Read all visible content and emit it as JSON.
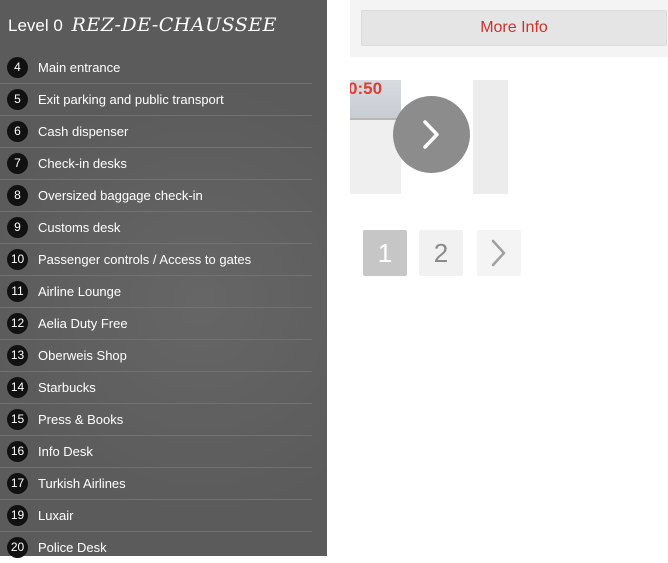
{
  "panel": {
    "level_label": "Level 0",
    "level_name": "REZ-DE-CHAUSSEE",
    "items": [
      {
        "num": "4",
        "label": "Main entrance"
      },
      {
        "num": "5",
        "label": "Exit parking and public transport"
      },
      {
        "num": "6",
        "label": "Cash dispenser"
      },
      {
        "num": "7",
        "label": "Check-in desks"
      },
      {
        "num": "8",
        "label": "Oversized baggage check-in"
      },
      {
        "num": "9",
        "label": "Customs desk"
      },
      {
        "num": "10",
        "label": "Passenger controls / Access to gates"
      },
      {
        "num": "11",
        "label": "Airline Lounge"
      },
      {
        "num": "12",
        "label": "Aelia Duty Free"
      },
      {
        "num": "13",
        "label": "Oberweis Shop"
      },
      {
        "num": "14",
        "label": "Starbucks"
      },
      {
        "num": "15",
        "label": "Press & Books"
      },
      {
        "num": "16",
        "label": "Info Desk"
      },
      {
        "num": "17",
        "label": "Turkish Airlines"
      },
      {
        "num": "19",
        "label": "Luxair"
      },
      {
        "num": "20",
        "label": "Police Desk"
      }
    ]
  },
  "info": {
    "more_info_label": "More Info",
    "accent_color": "#d0312d"
  },
  "carousel": {
    "thumb_time_text": "0:50",
    "next_icon": "chevron-right-icon"
  },
  "pager": {
    "pages": [
      "1",
      "2"
    ],
    "current_page": "1",
    "next_icon": "chevron-right-icon"
  }
}
